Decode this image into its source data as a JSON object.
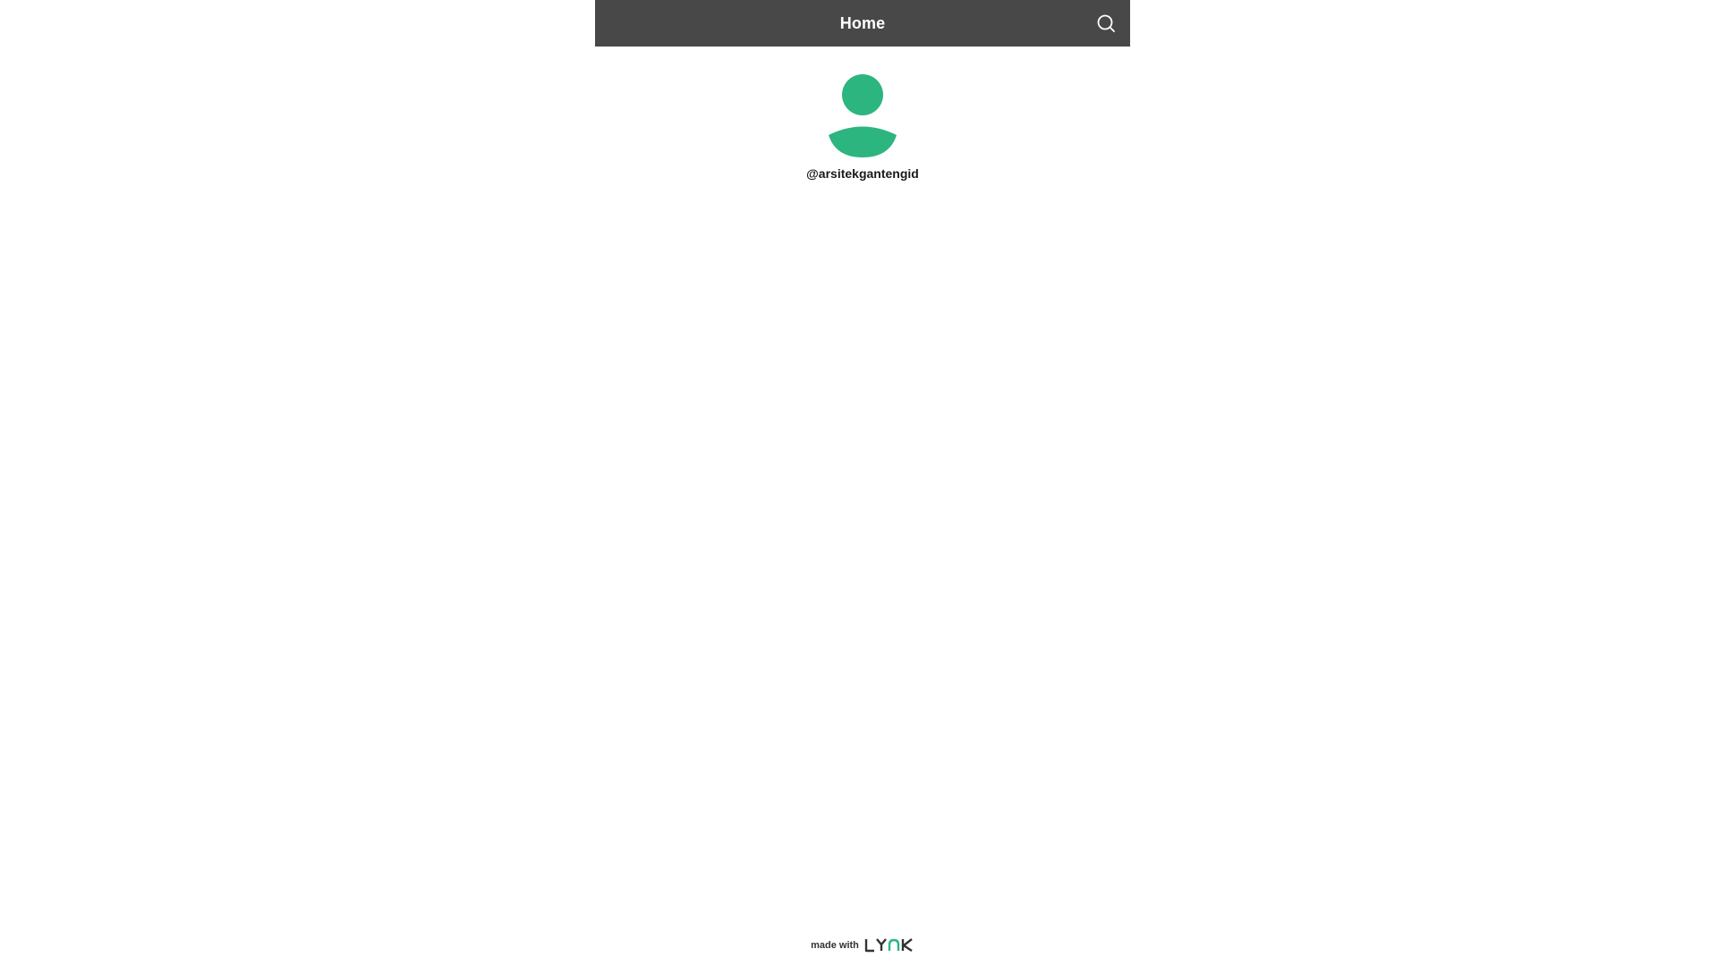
{
  "header": {
    "title": "Home",
    "search_icon": "search-icon",
    "background_color": "#484848"
  },
  "profile": {
    "avatar_icon": "user-avatar-icon",
    "avatar_color": "#2DB57F",
    "username": "@arsitekgantengid"
  },
  "footer": {
    "made_with": "made with",
    "brand": "LYNK"
  }
}
